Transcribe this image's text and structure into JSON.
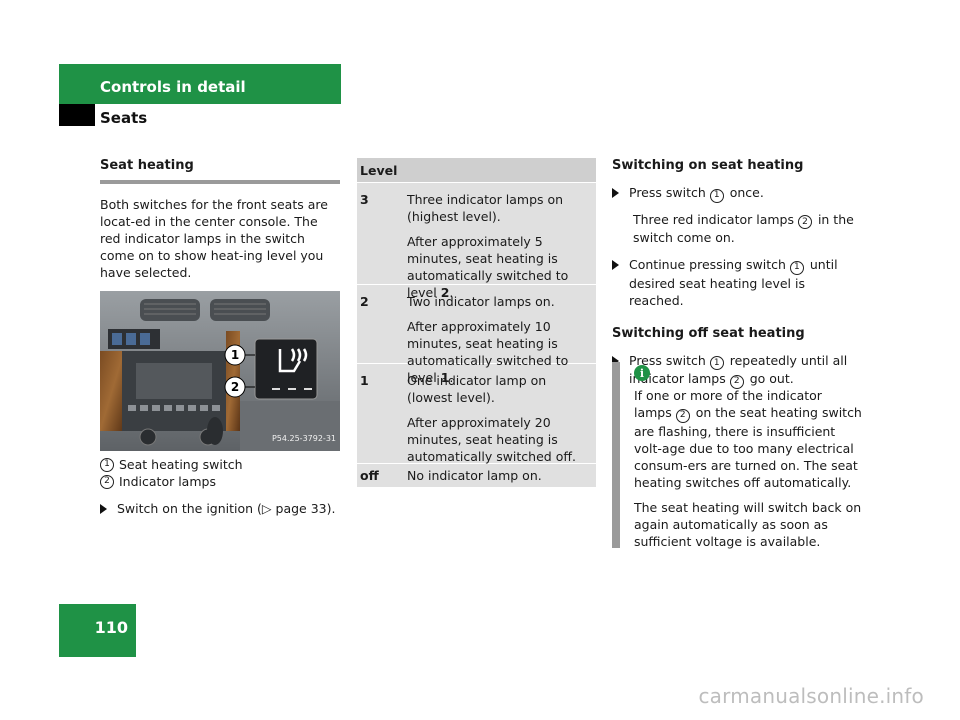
{
  "header": {
    "section": "Controls in detail",
    "subsection": "Seats"
  },
  "page_number": "110",
  "left": {
    "heading": "Seat heating",
    "intro": "Both switches for the front seats are locat-ed in the center console. The red indicator lamps in the switch come on to show heat-ing level you have selected.",
    "photo_code": "P54.25-3792-31",
    "captions": [
      {
        "num": "1",
        "text": "Seat heating switch"
      },
      {
        "num": "2",
        "text": "Indicator lamps"
      }
    ],
    "bullet": "Switch on the ignition (▷ page 33)."
  },
  "table": {
    "header": "Level",
    "rows": [
      {
        "level": "3",
        "line1": "Three indicator lamps on (highest level).",
        "line2a": "After approximately 5 minutes, seat heating is automatically switched to level ",
        "line2b": "2",
        "line2c": "."
      },
      {
        "level": "2",
        "line1": "Two indicator lamps on.",
        "line2a": "After approximately 10 minutes, seat heating is automatically switched to level ",
        "line2b": "1",
        "line2c": "."
      },
      {
        "level": "1",
        "line1": "One indicator lamp on (lowest level).",
        "line2a": "After approximately 20 minutes, seat heating is automatically switched off.",
        "line2b": "",
        "line2c": ""
      },
      {
        "level": "off",
        "line1": "No indicator lamp on.",
        "line2a": "",
        "line2b": "",
        "line2c": ""
      }
    ]
  },
  "right": {
    "on_heading": "Switching on seat heating",
    "on_step1a": "Press switch ",
    "on_step1b": " once.",
    "on_result_a": "Three red indicator lamps ",
    "on_result_b": " in the switch come on.",
    "on_step2a": "Continue pressing switch ",
    "on_step2b": " until desired seat heating level is reached.",
    "off_heading": "Switching off seat heating",
    "off_step_a": "Press switch ",
    "off_step_b": " repeatedly until all indicator lamps ",
    "off_step_c": " go out.",
    "info_icon": "i",
    "info_p1a": "If one or more of the indicator lamps ",
    "info_p1b": " on the seat heating switch are flashing, there is insufficient volt-age due to too many electrical consum-ers are turned on. The seat heating switches off automatically.",
    "info_p2": "The seat heating will switch back on again automatically as soon as sufficient voltage is available."
  },
  "watermark": "carmanualsonline.info"
}
